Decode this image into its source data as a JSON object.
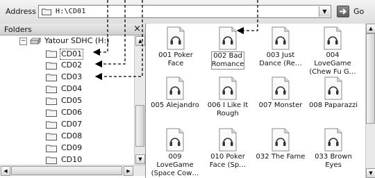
{
  "address_bar": {
    "label": "Address",
    "path": "H:\\CD01",
    "go_label": "Go"
  },
  "folders_pane": {
    "title": "Folders",
    "close_glyph": "×",
    "root": {
      "expander": "−",
      "label": "Yatour SDHC (H:)"
    },
    "folders": [
      {
        "label": "CD01",
        "selected": true
      },
      {
        "label": "CD02",
        "selected": false
      },
      {
        "label": "CD03",
        "selected": false
      },
      {
        "label": "CD04",
        "selected": false
      },
      {
        "label": "CD05",
        "selected": false
      },
      {
        "label": "CD06",
        "selected": false
      },
      {
        "label": "CD07",
        "selected": false
      },
      {
        "label": "CD08",
        "selected": false
      },
      {
        "label": "CD09",
        "selected": false
      },
      {
        "label": "CD10",
        "selected": false
      }
    ]
  },
  "files": [
    {
      "label": "001 Poker\nFace",
      "selected": false
    },
    {
      "label": "002 Bad\nRomance",
      "selected": true
    },
    {
      "label": "003 Just\nDance (Re…",
      "selected": false
    },
    {
      "label": "004 LoveGame\n(Chew Fu G…",
      "selected": false
    },
    {
      "label": "005 Alejandro",
      "selected": false
    },
    {
      "label": "006 I Like It\nRough",
      "selected": false
    },
    {
      "label": "007 Monster",
      "selected": false
    },
    {
      "label": "008 Paparazzi",
      "selected": false
    },
    {
      "label": "009 LoveGame\n(Space Cow…",
      "selected": false
    },
    {
      "label": "010 Poker\nFace (Sp…",
      "selected": false
    },
    {
      "label": "032 The Fame",
      "selected": false
    },
    {
      "label": "033 Brown\nEyes",
      "selected": false
    }
  ],
  "icons": {
    "address_folder": "folder-icon",
    "go": "go-arrow-icon",
    "drive": "drive-icon",
    "file": "audio-file-icon"
  },
  "colors": {
    "arrow": "#000000",
    "toolbar": "#e6e6e6",
    "pane_border": "#8c8c8c"
  }
}
